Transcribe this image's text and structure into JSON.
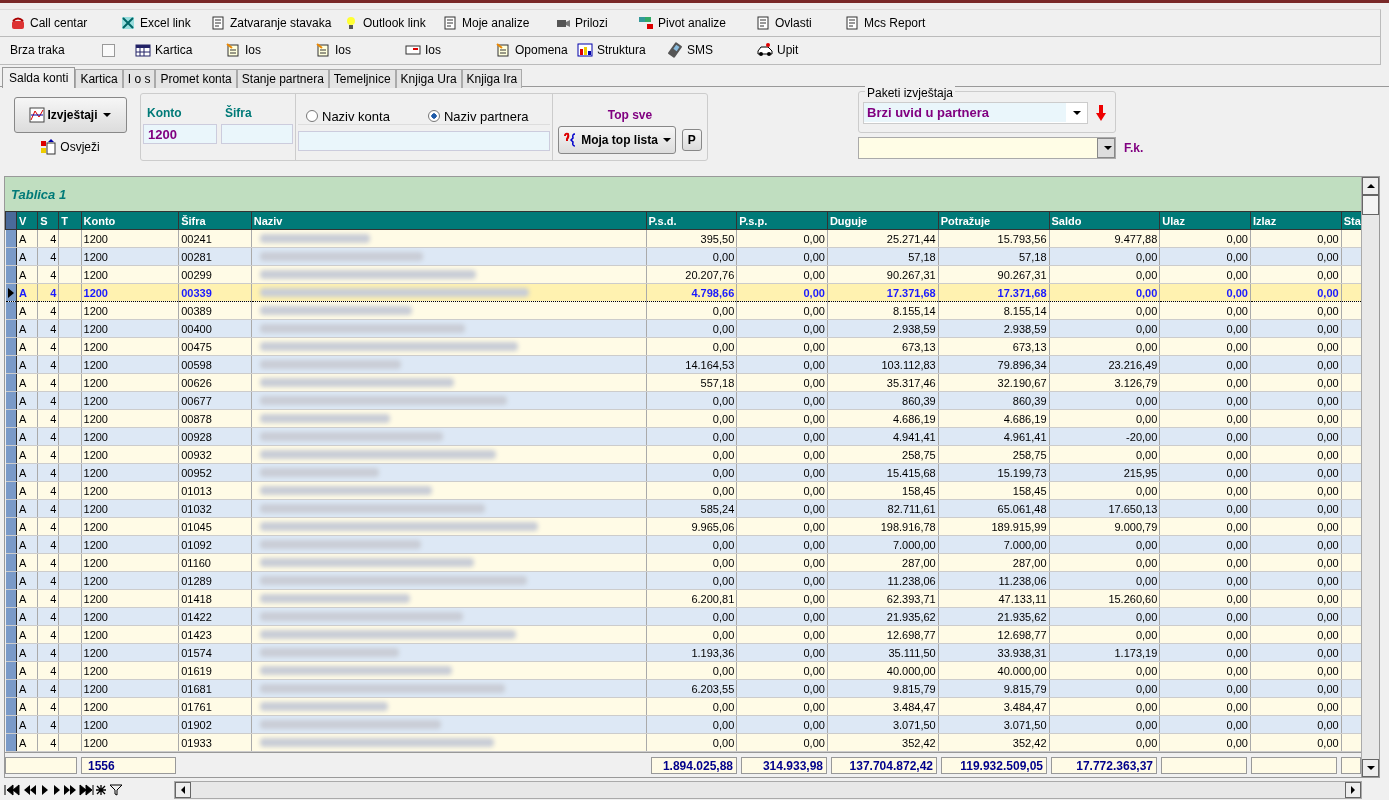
{
  "toolbar": {
    "items": [
      {
        "label": "Call centar"
      },
      {
        "label": "Excel link"
      },
      {
        "label": "Zatvaranje stavaka"
      },
      {
        "label": "Outlook link"
      },
      {
        "label": "Moje analize"
      },
      {
        "label": "Prilozi"
      },
      {
        "label": "Pivot analize"
      },
      {
        "label": "Ovlasti"
      },
      {
        "label": "Mcs Report"
      }
    ]
  },
  "quickbar": {
    "label": "Brza traka",
    "checked": false,
    "items": [
      {
        "label": "Kartica"
      },
      {
        "label": "Ios"
      },
      {
        "label": "Ios"
      },
      {
        "label": "Ios"
      },
      {
        "label": "Opomena"
      },
      {
        "label": "Struktura"
      },
      {
        "label": "SMS"
      },
      {
        "label": "Upit"
      }
    ]
  },
  "tabs": [
    {
      "label": "Salda konti",
      "selected": true
    },
    {
      "label": "Kartica",
      "selected": false
    },
    {
      "label": "I o s",
      "selected": false
    },
    {
      "label": "Promet konta",
      "selected": false
    },
    {
      "label": "Stanje partnera",
      "selected": false
    },
    {
      "label": "Temeljnice",
      "selected": false
    },
    {
      "label": "Knjiga Ura",
      "selected": false
    },
    {
      "label": "Knjiga Ira",
      "selected": false
    }
  ],
  "form": {
    "reports_button": "Izvještaji",
    "refresh": "Osvježi",
    "konto_label": "Konto",
    "konto_value": "1200",
    "sifra_label": "Šifra",
    "radios": [
      {
        "label": "Naziv konta",
        "selected": false
      },
      {
        "label": "Naziv partnera",
        "selected": true
      }
    ],
    "top_label": "Top sve",
    "top_button": "Moja top lista",
    "p_button": "P",
    "packages_legend": "Paketi izvještaja",
    "package_value": "Brzi uvid u partnera",
    "fk_label": "F.k."
  },
  "grid": {
    "title": "Tablica 1",
    "columns": [
      "V",
      "S",
      "T",
      "Konto",
      "Šifra",
      "Naziv",
      "P.s.d.",
      "P.s.p.",
      "Duguje",
      "Potražuje",
      "Saldo",
      "Ulaz",
      "Izlaz",
      "Sta"
    ],
    "rows": [
      {
        "v": "A",
        "s": "4",
        "konto": "1200",
        "sifra": "00241",
        "values": [
          "395,50",
          "0,00",
          "25.271,44",
          "15.793,56",
          "9.477,88",
          "0,00",
          "0,00"
        ],
        "selected": false
      },
      {
        "v": "A",
        "s": "4",
        "konto": "1200",
        "sifra": "00281",
        "values": [
          "0,00",
          "0,00",
          "57,18",
          "57,18",
          "0,00",
          "0,00",
          "0,00"
        ],
        "selected": false
      },
      {
        "v": "A",
        "s": "4",
        "konto": "1200",
        "sifra": "00299",
        "values": [
          "20.207,76",
          "0,00",
          "90.267,31",
          "90.267,31",
          "0,00",
          "0,00",
          "0,00"
        ],
        "selected": false
      },
      {
        "v": "A",
        "s": "4",
        "konto": "1200",
        "sifra": "00339",
        "values": [
          "4.798,66",
          "0,00",
          "17.371,68",
          "17.371,68",
          "0,00",
          "0,00",
          "0,00"
        ],
        "selected": true
      },
      {
        "v": "A",
        "s": "4",
        "konto": "1200",
        "sifra": "00389",
        "values": [
          "0,00",
          "0,00",
          "8.155,14",
          "8.155,14",
          "0,00",
          "0,00",
          "0,00"
        ],
        "selected": false
      },
      {
        "v": "A",
        "s": "4",
        "konto": "1200",
        "sifra": "00400",
        "values": [
          "0,00",
          "0,00",
          "2.938,59",
          "2.938,59",
          "0,00",
          "0,00",
          "0,00"
        ],
        "selected": false
      },
      {
        "v": "A",
        "s": "4",
        "konto": "1200",
        "sifra": "00475",
        "values": [
          "0,00",
          "0,00",
          "673,13",
          "673,13",
          "0,00",
          "0,00",
          "0,00"
        ],
        "selected": false
      },
      {
        "v": "A",
        "s": "4",
        "konto": "1200",
        "sifra": "00598",
        "values": [
          "14.164,53",
          "0,00",
          "103.112,83",
          "79.896,34",
          "23.216,49",
          "0,00",
          "0,00"
        ],
        "selected": false
      },
      {
        "v": "A",
        "s": "4",
        "konto": "1200",
        "sifra": "00626",
        "values": [
          "557,18",
          "0,00",
          "35.317,46",
          "32.190,67",
          "3.126,79",
          "0,00",
          "0,00"
        ],
        "selected": false
      },
      {
        "v": "A",
        "s": "4",
        "konto": "1200",
        "sifra": "00677",
        "values": [
          "0,00",
          "0,00",
          "860,39",
          "860,39",
          "0,00",
          "0,00",
          "0,00"
        ],
        "selected": false
      },
      {
        "v": "A",
        "s": "4",
        "konto": "1200",
        "sifra": "00878",
        "values": [
          "0,00",
          "0,00",
          "4.686,19",
          "4.686,19",
          "0,00",
          "0,00",
          "0,00"
        ],
        "selected": false
      },
      {
        "v": "A",
        "s": "4",
        "konto": "1200",
        "sifra": "00928",
        "values": [
          "0,00",
          "0,00",
          "4.941,41",
          "4.961,41",
          "-20,00",
          "0,00",
          "0,00"
        ],
        "selected": false
      },
      {
        "v": "A",
        "s": "4",
        "konto": "1200",
        "sifra": "00932",
        "values": [
          "0,00",
          "0,00",
          "258,75",
          "258,75",
          "0,00",
          "0,00",
          "0,00"
        ],
        "selected": false
      },
      {
        "v": "A",
        "s": "4",
        "konto": "1200",
        "sifra": "00952",
        "values": [
          "0,00",
          "0,00",
          "15.415,68",
          "15.199,73",
          "215,95",
          "0,00",
          "0,00"
        ],
        "selected": false
      },
      {
        "v": "A",
        "s": "4",
        "konto": "1200",
        "sifra": "01013",
        "values": [
          "0,00",
          "0,00",
          "158,45",
          "158,45",
          "0,00",
          "0,00",
          "0,00"
        ],
        "selected": false
      },
      {
        "v": "A",
        "s": "4",
        "konto": "1200",
        "sifra": "01032",
        "values": [
          "585,24",
          "0,00",
          "82.711,61",
          "65.061,48",
          "17.650,13",
          "0,00",
          "0,00"
        ],
        "selected": false
      },
      {
        "v": "A",
        "s": "4",
        "konto": "1200",
        "sifra": "01045",
        "values": [
          "9.965,06",
          "0,00",
          "198.916,78",
          "189.915,99",
          "9.000,79",
          "0,00",
          "0,00"
        ],
        "selected": false
      },
      {
        "v": "A",
        "s": "4",
        "konto": "1200",
        "sifra": "01092",
        "values": [
          "0,00",
          "0,00",
          "7.000,00",
          "7.000,00",
          "0,00",
          "0,00",
          "0,00"
        ],
        "selected": false
      },
      {
        "v": "A",
        "s": "4",
        "konto": "1200",
        "sifra": "01160",
        "values": [
          "0,00",
          "0,00",
          "287,00",
          "287,00",
          "0,00",
          "0,00",
          "0,00"
        ],
        "selected": false
      },
      {
        "v": "A",
        "s": "4",
        "konto": "1200",
        "sifra": "01289",
        "values": [
          "0,00",
          "0,00",
          "11.238,06",
          "11.238,06",
          "0,00",
          "0,00",
          "0,00"
        ],
        "selected": false
      },
      {
        "v": "A",
        "s": "4",
        "konto": "1200",
        "sifra": "01418",
        "values": [
          "6.200,81",
          "0,00",
          "62.393,71",
          "47.133,11",
          "15.260,60",
          "0,00",
          "0,00"
        ],
        "selected": false
      },
      {
        "v": "A",
        "s": "4",
        "konto": "1200",
        "sifra": "01422",
        "values": [
          "0,00",
          "0,00",
          "21.935,62",
          "21.935,62",
          "0,00",
          "0,00",
          "0,00"
        ],
        "selected": false
      },
      {
        "v": "A",
        "s": "4",
        "konto": "1200",
        "sifra": "01423",
        "values": [
          "0,00",
          "0,00",
          "12.698,77",
          "12.698,77",
          "0,00",
          "0,00",
          "0,00"
        ],
        "selected": false
      },
      {
        "v": "A",
        "s": "4",
        "konto": "1200",
        "sifra": "01574",
        "values": [
          "1.193,36",
          "0,00",
          "35.111,50",
          "33.938,31",
          "1.173,19",
          "0,00",
          "0,00"
        ],
        "selected": false
      },
      {
        "v": "A",
        "s": "4",
        "konto": "1200",
        "sifra": "01619",
        "values": [
          "0,00",
          "0,00",
          "40.000,00",
          "40.000,00",
          "0,00",
          "0,00",
          "0,00"
        ],
        "selected": false
      },
      {
        "v": "A",
        "s": "4",
        "konto": "1200",
        "sifra": "01681",
        "values": [
          "6.203,55",
          "0,00",
          "9.815,79",
          "9.815,79",
          "0,00",
          "0,00",
          "0,00"
        ],
        "selected": false
      },
      {
        "v": "A",
        "s": "4",
        "konto": "1200",
        "sifra": "01761",
        "values": [
          "0,00",
          "0,00",
          "3.484,47",
          "3.484,47",
          "0,00",
          "0,00",
          "0,00"
        ],
        "selected": false
      },
      {
        "v": "A",
        "s": "4",
        "konto": "1200",
        "sifra": "01902",
        "values": [
          "0,00",
          "0,00",
          "3.071,50",
          "3.071,50",
          "0,00",
          "0,00",
          "0,00"
        ],
        "selected": false
      },
      {
        "v": "A",
        "s": "4",
        "konto": "1200",
        "sifra": "01933",
        "values": [
          "0,00",
          "0,00",
          "352,42",
          "352,42",
          "0,00",
          "0,00",
          "0,00"
        ],
        "selected": false
      }
    ],
    "footer": {
      "count": "1556",
      "totals": [
        "1.894.025,88",
        "314.933,98",
        "137.704.872,42",
        "119.932.509,05",
        "17.772.363,37"
      ]
    }
  }
}
